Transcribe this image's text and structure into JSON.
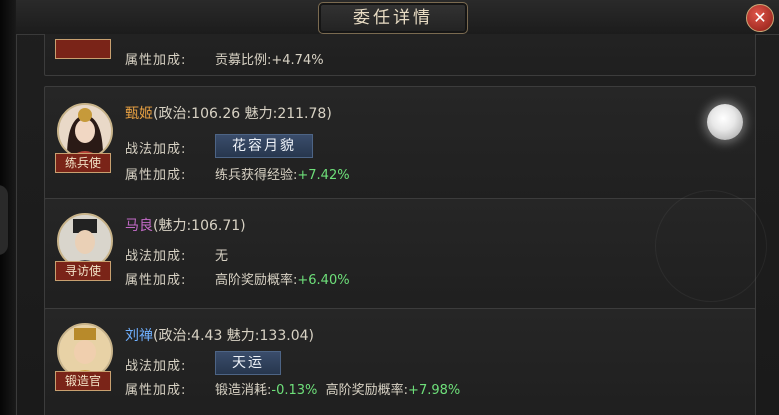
{
  "header": {
    "title": "委任详情",
    "close_label": "✕"
  },
  "partial_card": {
    "attr_label": "属性加成:",
    "attr_text": "贡募比例:+4.74%"
  },
  "cards": [
    {
      "name": "甄姬",
      "stats": "(政治:106.26 魅力:211.78)",
      "role": "练兵使",
      "skill_label": "战法加成:",
      "skill": "花容月貌",
      "attr_label": "属性加成:",
      "attr_name": "练兵获得经验:",
      "attr_value": "+7.42%"
    },
    {
      "name": "马良",
      "stats": "(魅力:106.71)",
      "role": "寻访使",
      "skill_label": "战法加成:",
      "skill": "无",
      "attr_label": "属性加成:",
      "attr_name": "高阶奖励概率:",
      "attr_value": "+6.40%"
    },
    {
      "name": "刘禅",
      "stats": "(政治:4.43 魅力:133.04)",
      "role": "锻造官",
      "skill_label": "战法加成:",
      "skill": "天运",
      "attr_label": "属性加成:",
      "attr_name": "锻造消耗:",
      "attr_value": "-0.13%",
      "attr_name2": "高阶奖励概率:",
      "attr_value2": "+7.98%"
    }
  ],
  "colors": {
    "name_orange": "#e7a042",
    "name_purple": "#c26ac6",
    "name_blue": "#6fb0ff",
    "percent_green": "#6ee07a"
  }
}
